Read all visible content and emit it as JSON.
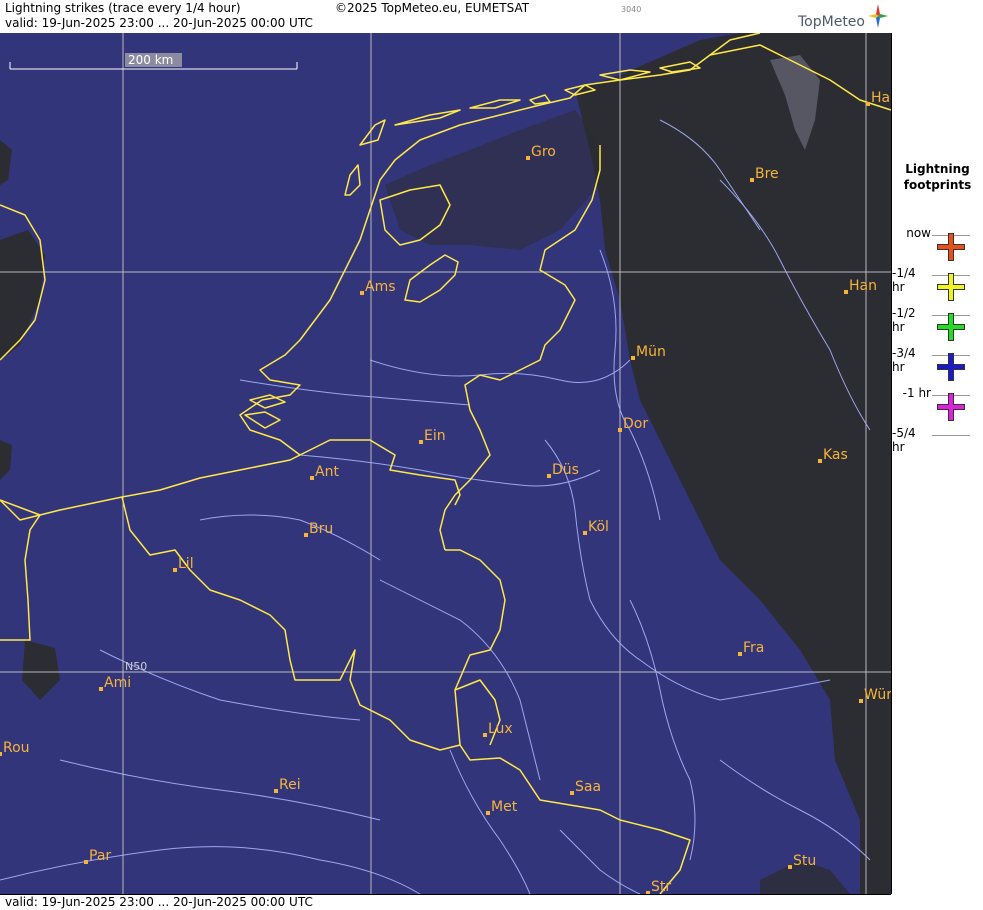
{
  "header": {
    "title": "Lightning strikes (trace every 1/4 hour)",
    "valid": "valid:  19-Jun-2025 23:00 ... 20-Jun-2025 00:00 UTC",
    "copyright": "©2025 TopMeteo.eu, EUMETSAT",
    "code": "3040",
    "brand": "TopMeteo"
  },
  "footer": {
    "valid": "valid:  19-Jun-2025 23:00 ... 20-Jun-2025 00:00 UTC"
  },
  "map": {
    "scale_label": "200 km",
    "latitude_label": "N50",
    "colors": {
      "background": "#33357a",
      "cloud": "#2f2f2f",
      "border": "#ffe84a",
      "river": "#a9b3ff",
      "grid": "#b9b9b9",
      "city": "#f5b43a"
    },
    "cities": [
      {
        "key": "groningen",
        "label": "Gro"
      },
      {
        "key": "bremen",
        "label": "Bre"
      },
      {
        "key": "hamburg",
        "label": "Ham"
      },
      {
        "key": "amsterdam",
        "label": "Ams"
      },
      {
        "key": "hannover",
        "label": "Han"
      },
      {
        "key": "munster",
        "label": "Mün"
      },
      {
        "key": "eindhoven",
        "label": "Ein"
      },
      {
        "key": "dortmund",
        "label": "Dor"
      },
      {
        "key": "antwerp",
        "label": "Ant"
      },
      {
        "key": "dusseldorf",
        "label": "Düs"
      },
      {
        "key": "kassel",
        "label": "Kas"
      },
      {
        "key": "brussels",
        "label": "Bru"
      },
      {
        "key": "koln",
        "label": "Köl"
      },
      {
        "key": "lille",
        "label": "Lil"
      },
      {
        "key": "frankfurt",
        "label": "Fra"
      },
      {
        "key": "amiens",
        "label": "Ami"
      },
      {
        "key": "wurzburg",
        "label": "Wür"
      },
      {
        "key": "luxembourg",
        "label": "Lux"
      },
      {
        "key": "rouen",
        "label": "Rou"
      },
      {
        "key": "reims",
        "label": "Rei"
      },
      {
        "key": "saarbrucken",
        "label": "Saa"
      },
      {
        "key": "metz",
        "label": "Met"
      },
      {
        "key": "paris",
        "label": "Par"
      },
      {
        "key": "stuttgart",
        "label": "Stu"
      },
      {
        "key": "strasbourg",
        "label": "Str"
      }
    ]
  },
  "legend": {
    "title_line1": "Lightning",
    "title_line2": "footprints",
    "items": [
      {
        "label": "now",
        "color": "#e8501a"
      },
      {
        "label": "-1/4 hr",
        "color": "#f2f21e"
      },
      {
        "label": "-1/2 hr",
        "color": "#22dd22"
      },
      {
        "label": "-3/4 hr",
        "color": "#1a1acc"
      },
      {
        "label": "-1 hr",
        "color": "#dd22dd"
      },
      {
        "label": "-5/4 hr",
        "color": ""
      }
    ]
  }
}
